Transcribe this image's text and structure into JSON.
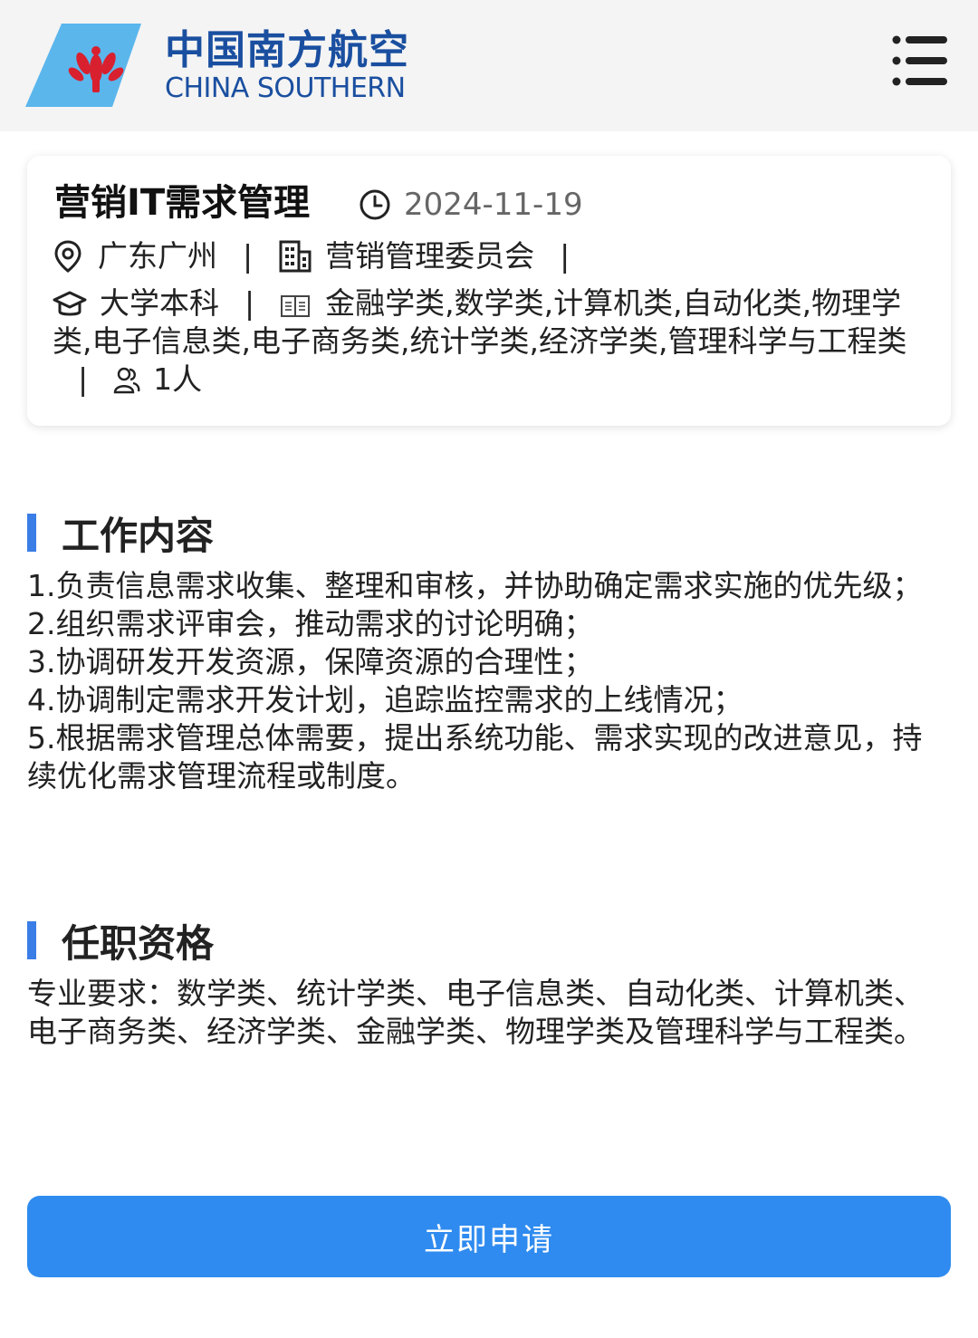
{
  "header": {
    "logo_cn": "中国南方航空",
    "logo_en": "CHINA SOUTHERN",
    "logo_icon": "china-southern-logo",
    "menu_icon": "list-menu-icon"
  },
  "job": {
    "title": "营销IT需求管理",
    "date": "2024-11-19",
    "location": "广东广州",
    "department": "营销管理委员会",
    "education": "大学本科",
    "majors": "金融学类,数学类,计算机类,自动化类,物理学类,电子信息类,电子商务类,统计学类,经济学类,管理科学与工程类",
    "headcount": "1人",
    "separator": "|"
  },
  "sections": {
    "duties_title": "工作内容",
    "duties": [
      "1.负责信息需求收集、整理和审核，并协助确定需求实施的优先级；",
      "2.组织需求评审会，推动需求的讨论明确；",
      "3.协调研发开发资源，保障资源的合理性；",
      "4.协调制定需求开发计划，追踪监控需求的上线情况；",
      "5.根据需求管理总体需要，提出系统功能、需求实现的改进意见，持续优化需求管理流程或制度。"
    ],
    "requirements_title": "任职资格",
    "requirements": "专业要求：数学类、统计学类、电子信息类、自动化类、计算机类、电子商务类、经济学类、金融学类、物理学类及管理科学与工程类。"
  },
  "actions": {
    "apply_label": "立即申请"
  },
  "colors": {
    "brand_blue": "#1a4fa0",
    "accent_blue": "#3a7de6",
    "button_blue": "#2f8bef",
    "logo_sky": "#5bb6ec",
    "logo_red": "#d8202f"
  }
}
